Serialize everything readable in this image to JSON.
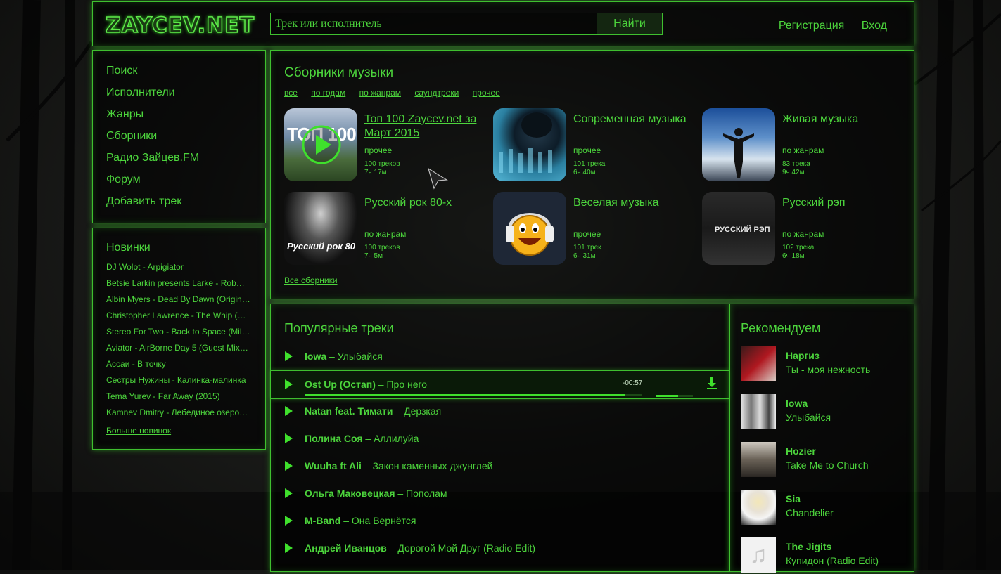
{
  "header": {
    "logo": "ZAYCEV.NET",
    "search_placeholder": "Трек или исполнитель",
    "search_button": "Найти",
    "register": "Регистрация",
    "login": "Вход"
  },
  "nav": {
    "items": [
      "Поиск",
      "Исполнители",
      "Жанры",
      "Сборники",
      "Радио Зайцев.FM",
      "Форум",
      "Добавить трек"
    ]
  },
  "news": {
    "title": "Новинки",
    "items": [
      "DJ Wolot - Arpigiator",
      "Betsie Larkin presents Larke - Rob…",
      "Albin Myers - Dead By Dawn (Origin…",
      "Christopher Lawrence - The Whip (…",
      "Stereo For Two - Back to Space (Mil…",
      "Aviator - AirBorne Day 5 (Guest Mix…",
      "Ассаи - В точку",
      "Сестры Нужины - Калинка-малинка",
      "Tema Yurev - Far Away (2015)",
      "Kamnev Dmitry - Лебединое озеро…"
    ],
    "more": "Больше новинок"
  },
  "collections": {
    "title": "Сборники музыки",
    "filters": [
      "все",
      "по годам",
      "по жанрам",
      "саундтреки",
      "прочее"
    ],
    "items": [
      {
        "title": "Топ 100 Zaycev.net за Март 2015",
        "category": "прочее",
        "tracks": "100 треков",
        "duration": "7ч 17м",
        "thumb_text": "ТОП 100"
      },
      {
        "title": "Современная музыка",
        "category": "прочее",
        "tracks": "101 трека",
        "duration": "6ч 40м",
        "thumb_text": ""
      },
      {
        "title": "Живая музыка",
        "category": "по жанрам",
        "tracks": "83 трека",
        "duration": "9ч 42м",
        "thumb_text": ""
      },
      {
        "title": "Русский рок 80-х",
        "category": "по жанрам",
        "tracks": "100 треков",
        "duration": "7ч 5м",
        "thumb_text": "Русский рок 80"
      },
      {
        "title": "Веселая музыка",
        "category": "прочее",
        "tracks": "101 трек",
        "duration": "6ч 31м",
        "thumb_text": ""
      },
      {
        "title": "Русский рэп",
        "category": "по жанрам",
        "tracks": "102 трека",
        "duration": "6ч 18м",
        "thumb_text": "РУССКИЙ РЭП"
      }
    ],
    "all_link": "Все сборники"
  },
  "popular": {
    "title": "Популярные треки",
    "tracks": [
      {
        "artist": "Iowa",
        "song": "Улыбайся"
      },
      {
        "artist": "Ost Up (Остап)",
        "song": "Про него",
        "time": "-00:57",
        "progress": 0.95,
        "volume": 0.6
      },
      {
        "artist": "Natan feat. Тимати",
        "song": "Дерзкая"
      },
      {
        "artist": "Полина Соя",
        "song": "Аллилуйа"
      },
      {
        "artist": "Wuuha ft Ali",
        "song": "Закон каменных джунглей"
      },
      {
        "artist": "Ольга Маковецкая",
        "song": "Пополам"
      },
      {
        "artist": "M-Band",
        "song": "Она Вернётся"
      },
      {
        "artist": "Андрей Иванцов",
        "song": "Дорогой Мой Друг (Radio Edit)"
      }
    ],
    "separator": " – "
  },
  "recommend": {
    "title": "Рекомендуем",
    "items": [
      {
        "artist": "Наргиз",
        "song": "Ты - моя нежность"
      },
      {
        "artist": "Iowa",
        "song": "Улыбайся"
      },
      {
        "artist": "Hozier",
        "song": "Take Me to Church"
      },
      {
        "artist": "Sia",
        "song": "Chandelier"
      },
      {
        "artist": "The Jigits",
        "song": "Купидон (Radio Edit)"
      }
    ]
  },
  "colors": {
    "accent": "#4cd43c",
    "glow": "#3fbf2f"
  },
  "icons": [
    "play-icon",
    "download-icon",
    "cursor-icon"
  ]
}
